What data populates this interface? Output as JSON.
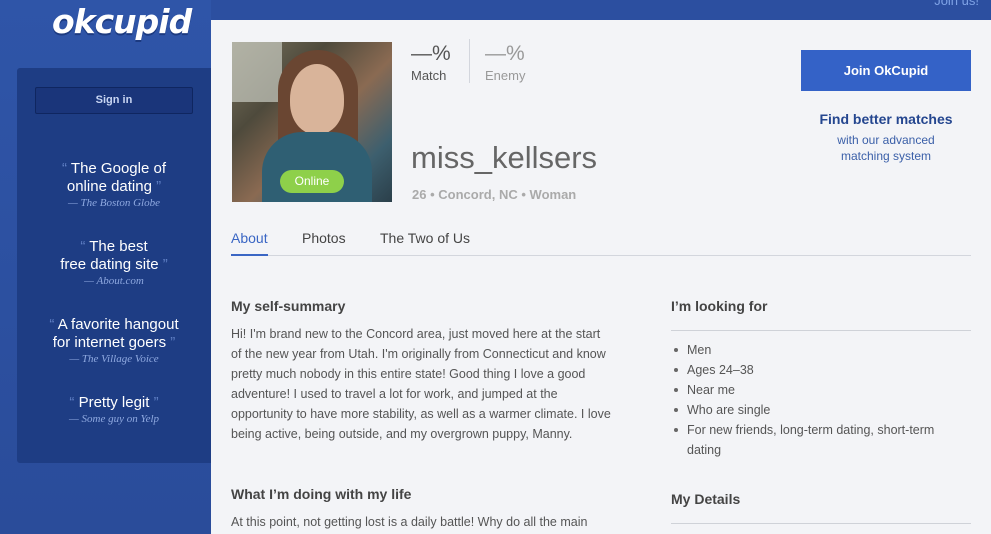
{
  "header": {
    "join_us": "Join us!"
  },
  "brand": {
    "logo": "okcupid"
  },
  "sidebar": {
    "signin_label": "Sign in",
    "quotes": [
      {
        "line1": "The Google of",
        "line2": "online dating",
        "source": "— The Boston Globe"
      },
      {
        "line1": "The best",
        "line2": "free dating site",
        "source": "— About.com"
      },
      {
        "line1": "A favorite hangout",
        "line2": "for internet goers",
        "source": "— The Village Voice"
      },
      {
        "line1": "Pretty legit",
        "line2": "",
        "source": "— Some guy on Yelp"
      }
    ]
  },
  "profile": {
    "online_badge": "Online",
    "match": {
      "value": "—%",
      "label": "Match"
    },
    "enemy": {
      "value": "—%",
      "label": "Enemy"
    },
    "username": "miss_kellsers",
    "age": "26",
    "location": "Concord, NC",
    "gender": "Woman",
    "separator": "•"
  },
  "cta": {
    "join_label": "Join OkCupid",
    "better_heading": "Find better matches",
    "better_sub_line1": "with our advanced",
    "better_sub_line2": "matching system"
  },
  "tabs": [
    {
      "label": "About",
      "active": true
    },
    {
      "label": "Photos",
      "active": false
    },
    {
      "label": "The Two of Us",
      "active": false
    }
  ],
  "essays": {
    "summary_heading": "My self-summary",
    "summary_lines": [
      "Hi! I'm brand new to the Concord area, just moved here at the start",
      "of the new year from Utah. I'm originally from Connecticut and know",
      "pretty much nobody in this entire state! Good thing I love a good",
      "adventure! I used to travel a lot for work, and jumped at the",
      "opportunity to have more stability, as well as a warmer climate. I love",
      "being active, being outside, and my overgrown puppy, Manny."
    ],
    "life_heading": "What I’m doing with my life",
    "life_text": "At this point, not getting lost is a daily battle! Why do all the main"
  },
  "looking_for": {
    "heading": "I’m looking for",
    "items": [
      "Men",
      "Ages 24–38",
      "Near me",
      "Who are single",
      "For new friends, long-term dating, short-term dating"
    ]
  },
  "details": {
    "heading": "My Details"
  },
  "colors": {
    "brand_blue": "#2c4fa0",
    "panel_navy": "#1e3d84",
    "cta_blue": "#3462c7",
    "online_green": "#8ed04a",
    "active_tab": "#3a66c4"
  }
}
